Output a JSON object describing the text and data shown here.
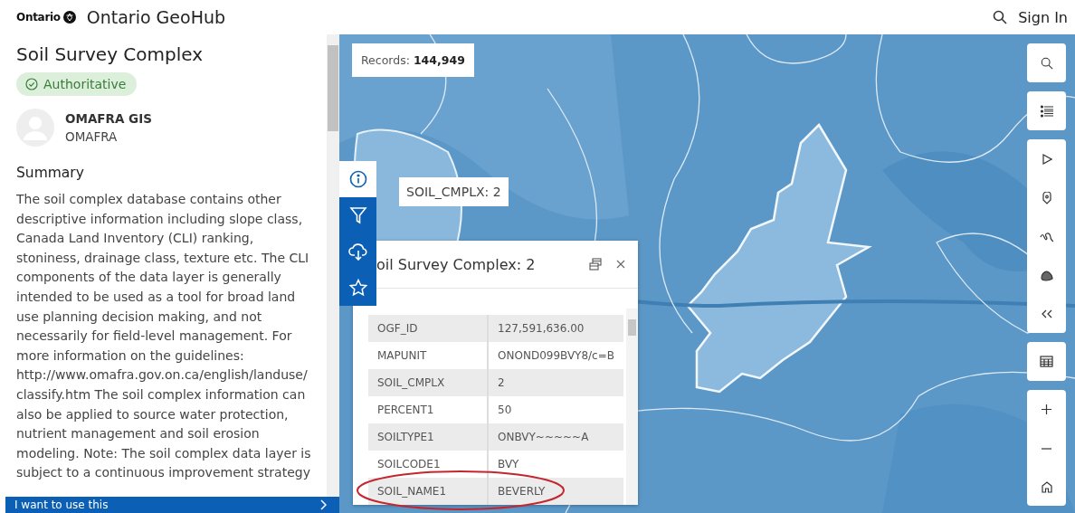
{
  "header": {
    "logo_text": "Ontario",
    "site_title": "Ontario GeoHub",
    "sign_in": "Sign In"
  },
  "panel": {
    "title": "Soil Survey Complex",
    "badge": "Authoritative",
    "owner_name": "OMAFRA GIS",
    "owner_org": "OMAFRA",
    "summary_heading": "Summary",
    "summary": "The soil complex database contains other descriptive information including slope class, Canada Land Inventory (CLI) ranking, stoniness, drainage class, texture etc. The CLI components of the data layer is generally intended to be used as a tool for broad land use planning decision making, and not necessarily for field-level management. For more information on the guidelines: http://www.omafra.gov.on.ca/english/landuse/ classify.htm The soil complex information can also be applied to source water protection, nutrient management and soil erosion modeling. Note: The soil complex data layer is subject to a continuous improvement strategy",
    "action_bar": "I want to use this"
  },
  "map": {
    "records_label": "Records:",
    "records_count": "144,949",
    "tooltip": "SOIL_CMPLX: 2",
    "side_tools": [
      {
        "kind": "info",
        "selected": true
      },
      {
        "kind": "filter",
        "selected": false
      },
      {
        "kind": "download",
        "selected": false
      },
      {
        "kind": "favorite",
        "selected": false
      }
    ],
    "popup": {
      "title": "oil Survey Complex: 2",
      "rows": [
        {
          "field": "OGF_ID",
          "value": "127,591,636.00",
          "circled": false
        },
        {
          "field": "MAPUNIT",
          "value": "ONOND099BVY8/c=B",
          "circled": false
        },
        {
          "field": "SOIL_CMPLX",
          "value": "2",
          "circled": false
        },
        {
          "field": "PERCENT1",
          "value": "50",
          "circled": false
        },
        {
          "field": "SOILTYPE1",
          "value": "ONBVY~~~~~A",
          "circled": false
        },
        {
          "field": "SOILCODE1",
          "value": "BVY",
          "circled": false
        },
        {
          "field": "SOIL_NAME1",
          "value": "BEVERLY",
          "circled": true
        }
      ]
    }
  }
}
